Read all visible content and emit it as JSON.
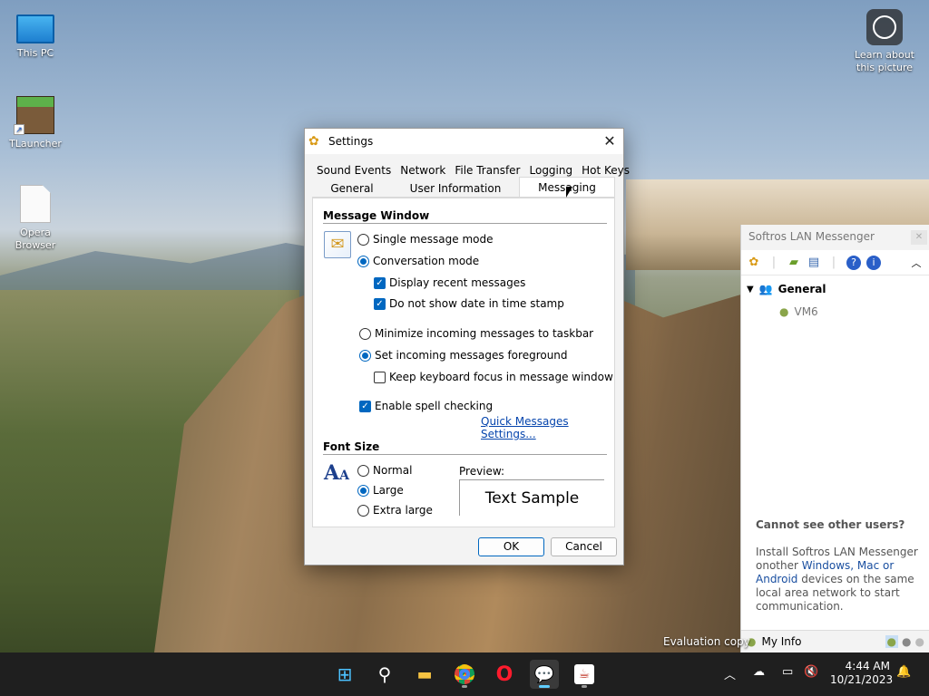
{
  "desktop": {
    "icons": [
      {
        "label": "This PC"
      },
      {
        "label": "TLauncher"
      },
      {
        "label": "Opera Browser"
      }
    ],
    "learn_label": "Learn about this picture",
    "watermark": "Evaluation copy"
  },
  "dialog": {
    "title": "Settings",
    "tabs_row1": [
      "Sound Events",
      "Network",
      "File Transfer",
      "Logging",
      "Hot Keys"
    ],
    "tabs_row2": [
      "General",
      "User Information",
      "Messaging"
    ],
    "active_tab": "Messaging",
    "message_window": {
      "heading": "Message Window",
      "single_mode": "Single message mode",
      "conversation_mode": "Conversation mode",
      "display_recent": "Display recent messages",
      "no_date": "Do not show date in time stamp",
      "minimize_taskbar": "Minimize incoming messages to taskbar",
      "set_foreground": "Set incoming messages foreground",
      "keep_focus": "Keep keyboard focus in message window",
      "spell_check": "Enable spell checking",
      "quick_link": "Quick Messages Settings..."
    },
    "font_size": {
      "heading": "Font Size",
      "normal": "Normal",
      "large": "Large",
      "extra_large": "Extra large",
      "preview_label": "Preview:",
      "preview_text": "Text Sample"
    },
    "ok_label": "OK",
    "cancel_label": "Cancel"
  },
  "messenger": {
    "title": "Softros LAN Messenger",
    "group": "General",
    "user": "VM6",
    "cannot_see": "Cannot see other users?",
    "install_a": "Install Softros LAN Messenger onother ",
    "install_link": "Windows, Mac or Android",
    "install_b": " devices on the same local area network to start communication.",
    "my_info": "My Info"
  },
  "taskbar": {
    "time": "4:44 AM",
    "date": "10/21/2023"
  }
}
